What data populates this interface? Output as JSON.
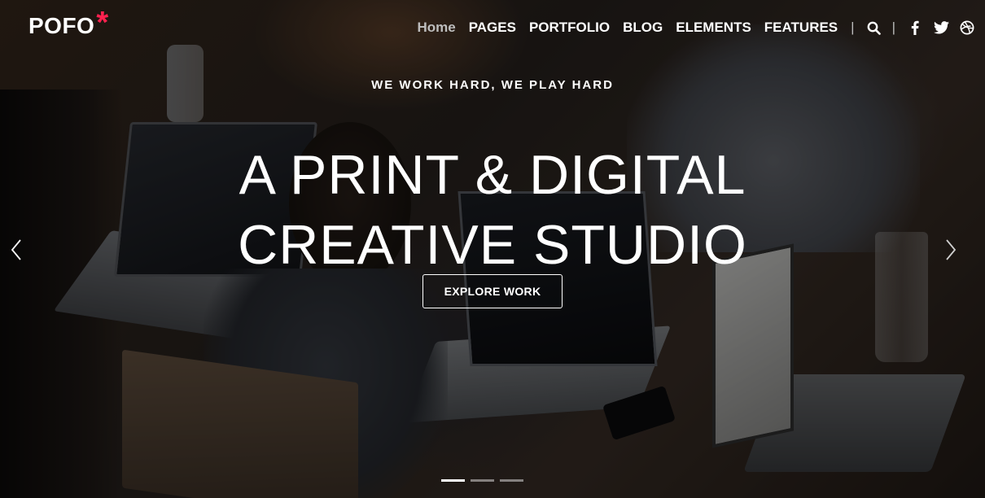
{
  "brand": {
    "name": "POFO",
    "mark": "*",
    "mark_color": "#ff214f"
  },
  "nav": {
    "items": [
      {
        "label": "Home",
        "active": true
      },
      {
        "label": "PAGES"
      },
      {
        "label": "PORTFOLIO"
      },
      {
        "label": "BLOG"
      },
      {
        "label": "ELEMENTS"
      },
      {
        "label": "FEATURES"
      }
    ],
    "separator": "|",
    "icons": [
      "search-icon",
      "facebook-icon",
      "twitter-icon",
      "dribbble-icon"
    ]
  },
  "hero": {
    "tagline": "WE WORK HARD, WE PLAY HARD",
    "title_line1": "A PRINT & DIGITAL",
    "title_line2": "CREATIVE STUDIO",
    "cta_label": "EXPLORE WORK"
  },
  "slider": {
    "prev_icon": "chevron-left-icon",
    "next_icon": "chevron-right-icon",
    "slide_count": 3,
    "active_slide": 1
  },
  "colors": {
    "text": "#ffffff",
    "inactive_nav": "#bdbdbd",
    "accent": "#ff214f"
  }
}
